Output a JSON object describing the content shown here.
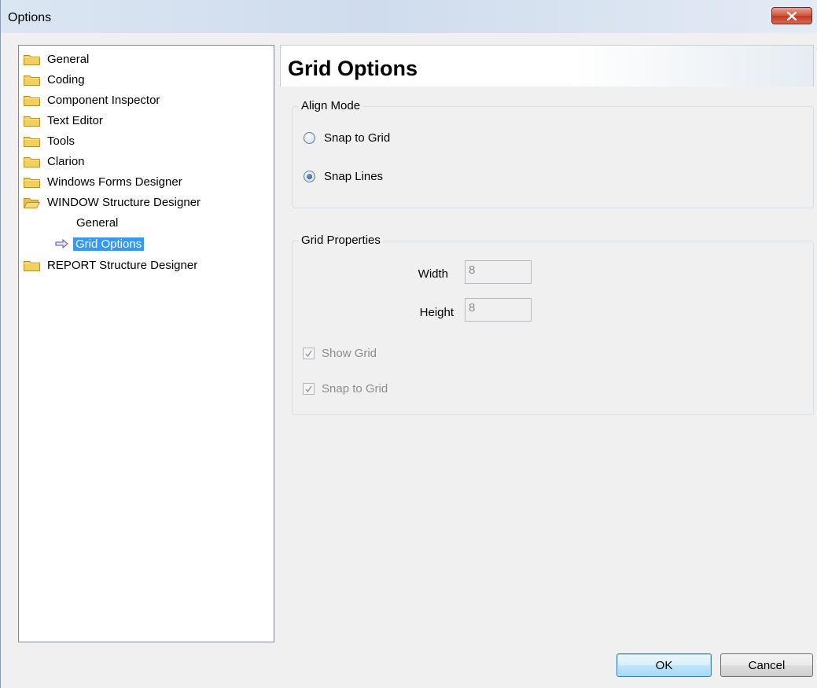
{
  "window": {
    "title": "Options"
  },
  "tree": {
    "items": [
      {
        "label": "General",
        "icon": "folder-closed-icon"
      },
      {
        "label": "Coding",
        "icon": "folder-closed-icon"
      },
      {
        "label": "Component Inspector",
        "icon": "folder-closed-icon"
      },
      {
        "label": "Text Editor",
        "icon": "folder-closed-icon"
      },
      {
        "label": "Tools",
        "icon": "folder-closed-icon"
      },
      {
        "label": "Clarion",
        "icon": "folder-closed-icon"
      },
      {
        "label": "Windows Forms Designer",
        "icon": "folder-closed-icon"
      },
      {
        "label": "WINDOW Structure Designer",
        "icon": "folder-open-icon",
        "children": [
          {
            "label": "General"
          },
          {
            "label": "Grid Options",
            "selected": true,
            "icon": "arrow-right-icon"
          }
        ]
      },
      {
        "label": "REPORT Structure Designer",
        "icon": "folder-closed-icon"
      }
    ]
  },
  "panel": {
    "title": "Grid Options",
    "align_mode": {
      "title": "Align Mode",
      "options": [
        {
          "label": "Snap to Grid",
          "checked": false
        },
        {
          "label": "Snap Lines",
          "checked": true
        }
      ]
    },
    "grid_properties": {
      "title": "Grid Properties",
      "width_label": "Width",
      "width_value": "8",
      "height_label": "Height",
      "height_value": "8",
      "show_grid_label": "Show Grid",
      "show_grid_checked": true,
      "snap_to_grid_label": "Snap to Grid",
      "snap_to_grid_checked": true
    }
  },
  "buttons": {
    "ok": "OK",
    "cancel": "Cancel"
  },
  "colors": {
    "selection": "#3399ff",
    "folder": "#f3cf5f",
    "disabled_text": "#8d8d8d"
  }
}
